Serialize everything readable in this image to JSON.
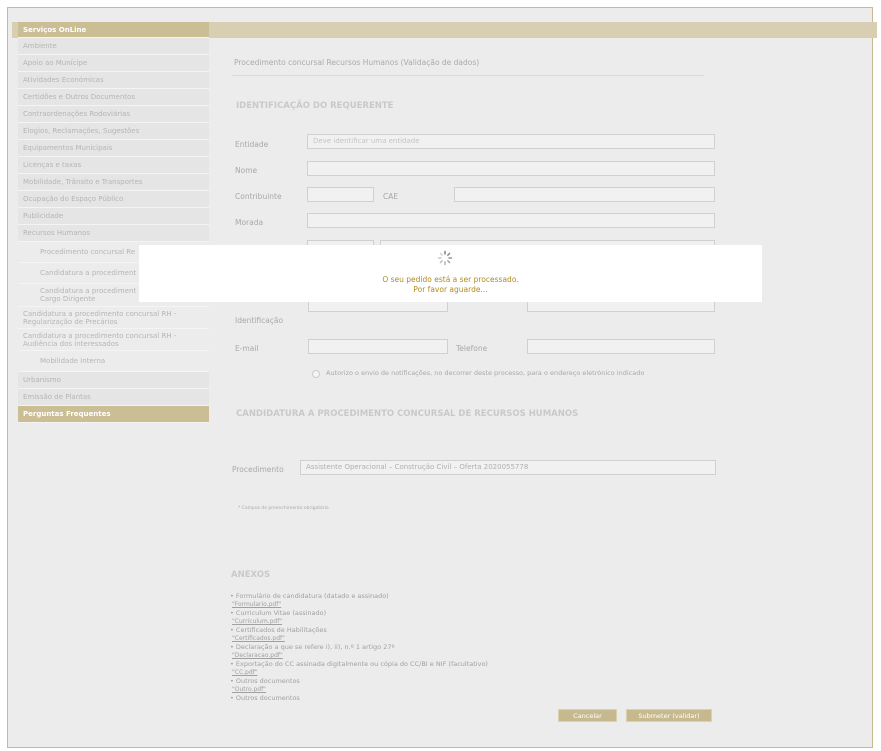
{
  "sidebar": {
    "header": "Serviços OnLine",
    "items": [
      "Ambiente",
      "Apoio ao Munícipe",
      "Atividades Económicas",
      "Certidões e Outros Documentos",
      "Contraordenações Rodoviárias",
      "Elogios, Reclamações, Sugestões",
      "Equipamentos Municipais",
      "Licenças e taxas",
      "Mobilidade, Trânsito e Transportes",
      "Ocupação do Espaço Público",
      "Publicidade",
      "Recursos Humanos"
    ],
    "sub_items": [
      "Procedimento concursal Re",
      "Candidatura a procediment"
    ],
    "sub_items_multi": [
      [
        "Candidatura a procediment",
        "Cargo Dirigente"
      ],
      [
        "Candidatura a procedimento concursal RH -",
        "Regularização de Precários"
      ],
      [
        "Candidatura a procedimento concursal RH -",
        "Audiência dos interessados"
      ]
    ],
    "sub_item_last": "Mobilidade interna",
    "items_after": [
      "Urbanismo",
      "Emissão de Plantas"
    ],
    "footer": "Perguntas Frequentes"
  },
  "page": {
    "title": "Procedimento concursal Recursos Humanos (Validação de dados)",
    "section1": "IDENTIFICAÇÃO DO REQUERENTE",
    "labels": {
      "entidade": "Entidade",
      "nome": "Nome",
      "contribuinte": "Contribuinte",
      "cae": "CAE",
      "morada": "Morada",
      "identificacao": "Identificação",
      "email": "E-mail",
      "telefone": "Telefone",
      "procedimento": "Procedimento"
    },
    "entidade_placeholder": "Deve identificar uma entidade",
    "checkbox_label": "Autorizo o envio de notificações, no decorrer deste processo, para o endereço eletrónico indicado",
    "section2": "CANDIDATURA A PROCEDIMENTO CONCURSAL DE RECURSOS HUMANOS",
    "procedimento_required": "*",
    "procedimento_value": "Assistente Operacional – Construção Civil – Oferta 2020055778",
    "note": "* Campos de preenchimento obrigatório",
    "annex_title": "ANEXOS",
    "annex_items": [
      "Formulário de candidatura (datado e assinado)",
      "Curriculum Vitae (assinado)",
      "Certificados de Habilitações",
      "Declaração a que se refere i), ii), n.º 1 artigo 27º",
      "Exportação do CC assinada digitalmente ou cópia do CC/BI e NIF (facultativo)",
      "Outros documentos",
      "Outros documentos"
    ],
    "annex_links": [
      "\"Formulario.pdf\"",
      "\"Curriculum.pdf\"",
      "\"Certificados.pdf\"",
      "\"Declaracao.pdf\"",
      "\"CC.pdf\"",
      "\"Outro.pdf\""
    ],
    "btn_cancel": "Cancelar",
    "btn_submit": "Submeter (validar)"
  },
  "overlay": {
    "line1": "O seu pedido está a ser processado.",
    "line2": "Por favor aguarde..."
  }
}
